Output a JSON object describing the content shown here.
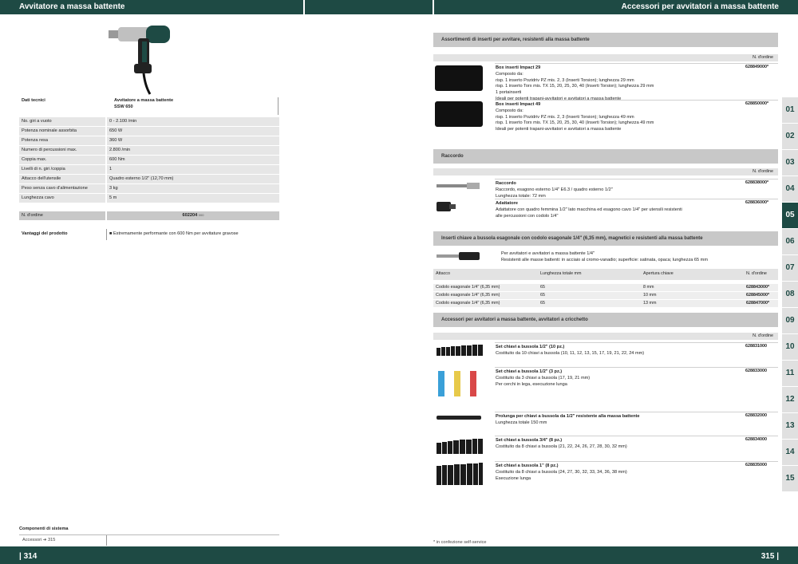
{
  "left_header": {
    "title": "Avvitatore a massa battente"
  },
  "right_header": {
    "title": "Accessori per avvitatori a massa battente"
  },
  "product": {
    "tech_label": "Dati tecnici",
    "name_line1": "Avvitatore a massa battente",
    "name_line2": "SSW 650",
    "specs": [
      {
        "k": "No. giri a vuoto",
        "v": "0 - 2.100 /min"
      },
      {
        "k": "Potenza nominale assorbita",
        "v": "650 W"
      },
      {
        "k": "Potenza resa",
        "v": "360 W"
      },
      {
        "k": "Numero di percussioni max.",
        "v": "2.800 /min"
      },
      {
        "k": "Coppia max.",
        "v": "600 Nm"
      },
      {
        "k": "Livelli di n. giri /coppia",
        "v": "1"
      },
      {
        "k": "Attacco dell'utensile",
        "v": "Quadro esterno 1/2\" (12,70 mm)"
      },
      {
        "k": "Peso senza cavo d'alimentazione",
        "v": "3 kg"
      },
      {
        "k": "Lunghezza cavo",
        "v": "5 m"
      }
    ],
    "order_label": "N. d'ordine",
    "order_no": "602204",
    "order_suffix": "000",
    "advantages_label": "Vantaggi del prodotto",
    "advantage": "Estremamente performante con 600 Nm per avvitature gravose"
  },
  "system": {
    "label": "Componenti di sistema",
    "link": "Accessori  ➜  315"
  },
  "footnote": "* in confezione self-service",
  "page_left": "| 314",
  "page_right": "315 |",
  "sections": {
    "s1": {
      "title": "Assortimenti di inserti per avvitare, resistenti alla massa battente",
      "col": "N. d'ordine",
      "items": [
        {
          "name": "Box inserti Impact 29",
          "lines": [
            "Composto da:",
            "risp. 1 inserto Pozidriv PZ mis. 2, 3 (Inserti Torsion); lunghezza 29 mm",
            "risp. 1 inserto Torx mis. TX 15, 20, 25, 30, 40 (Inserti Torsion); lunghezza 29 mm",
            "1 portainserti",
            "Ideali per potenti trapani-avvitatori e avvitatori a massa battente"
          ],
          "no": "628849000*"
        },
        {
          "name": "Box inserti Impact 49",
          "lines": [
            "Composto da:",
            "risp. 1 inserto Pozidriv PZ mis. 2, 3 (Inserti Torsion); lunghezza 49 mm",
            "risp. 1 inserto Torx mis. TX 15, 20, 25, 30, 40 (Inserti Torsion); lunghezza 49 mm",
            "Ideali per potenti trapani-avvitatori e avvitatori a massa battente"
          ],
          "no": "628850000*"
        }
      ]
    },
    "s2": {
      "title": "Raccordo",
      "col": "N. d'ordine",
      "items": [
        {
          "name": "Raccordo",
          "lines": [
            "Raccordo, esagono esterno 1/4\" E6.3 / quadro esterno 1/2\"",
            "Lunghezza totale: 72 mm"
          ],
          "no": "628838000*"
        },
        {
          "name": "Adattatore",
          "lines": [
            "Adattatore con quadro femmina 1/2\" lato macchina ed esagono cavo 1/4\" per utensili resistenti",
            "alle percussioni con codolo 1/4\""
          ],
          "no": "628836000*"
        }
      ]
    },
    "s3": {
      "title": "Inserti chiave a bussola esagonale con codolo esagonale 1/4\" (6,35 mm), magnetici e resistenti alla massa battente",
      "desc": [
        "Per avvitatori e avvitatori a massa battente 1/4\"",
        "Resistenti alle masse battenti: in acciaio al cromo-vanadio; superficie: satinata, opaca; lunghezza 65 mm"
      ],
      "cols": [
        "Attacco",
        "Lunghezza totale mm",
        "Apertura chiave",
        "N. d'ordine"
      ],
      "rows": [
        [
          "Codolo esagonale 1/4\" (6,35 mm)",
          "65",
          "8 mm",
          "628843000*"
        ],
        [
          "Codolo esagonale 1/4\" (6,35 mm)",
          "65",
          "10 mm",
          "628845000*"
        ],
        [
          "Codolo esagonale 1/4\" (6,35 mm)",
          "65",
          "13 mm",
          "628847000*"
        ]
      ]
    },
    "s4": {
      "title": "Accessori per avvitatori a massa battente, avvitatori a cricchetto",
      "col": "N. d'ordine",
      "items": [
        {
          "name": "Set chiavi a bussola 1/2\" (10 pz.)",
          "lines": [
            "Costituito da 10 chiavi a bussola (10, 11, 12, 13, 15, 17, 19, 21, 22, 24 mm)"
          ],
          "no": "628831000"
        },
        {
          "name": "Set chiavi a bussola 1/2\" (3 pz.)",
          "lines": [
            "Costituito da 3 chiavi a bussola (17, 19, 21 mm)",
            "Per cerchi in lega, esecuzione lunga"
          ],
          "no": "628833000"
        },
        {
          "name": "Prolunga per chiavi a bussola da 1/2\" resistente alla massa battente",
          "lines": [
            "Lunghezza totale 150 mm"
          ],
          "no": "628832000"
        },
        {
          "name": "Set chiavi a bussola 3/4\" (8 pz.)",
          "lines": [
            "Costituito da 8 chiavi a bussola (21, 22, 24, 26, 27, 28, 30, 32 mm)"
          ],
          "no": "628834000"
        },
        {
          "name": "Set chiavi a bussola 1\" (8 pz.)",
          "lines": [
            "Costituito da 8 chiavi a bussola (24, 27, 30, 32, 33, 34, 36, 38 mm)",
            "Esecuzione lunga"
          ],
          "no": "628835000"
        }
      ]
    }
  },
  "tabs": [
    "01",
    "02",
    "03",
    "04",
    "05",
    "06",
    "07",
    "08",
    "09",
    "10",
    "11",
    "12",
    "13",
    "14",
    "15"
  ],
  "active_tab": "05"
}
